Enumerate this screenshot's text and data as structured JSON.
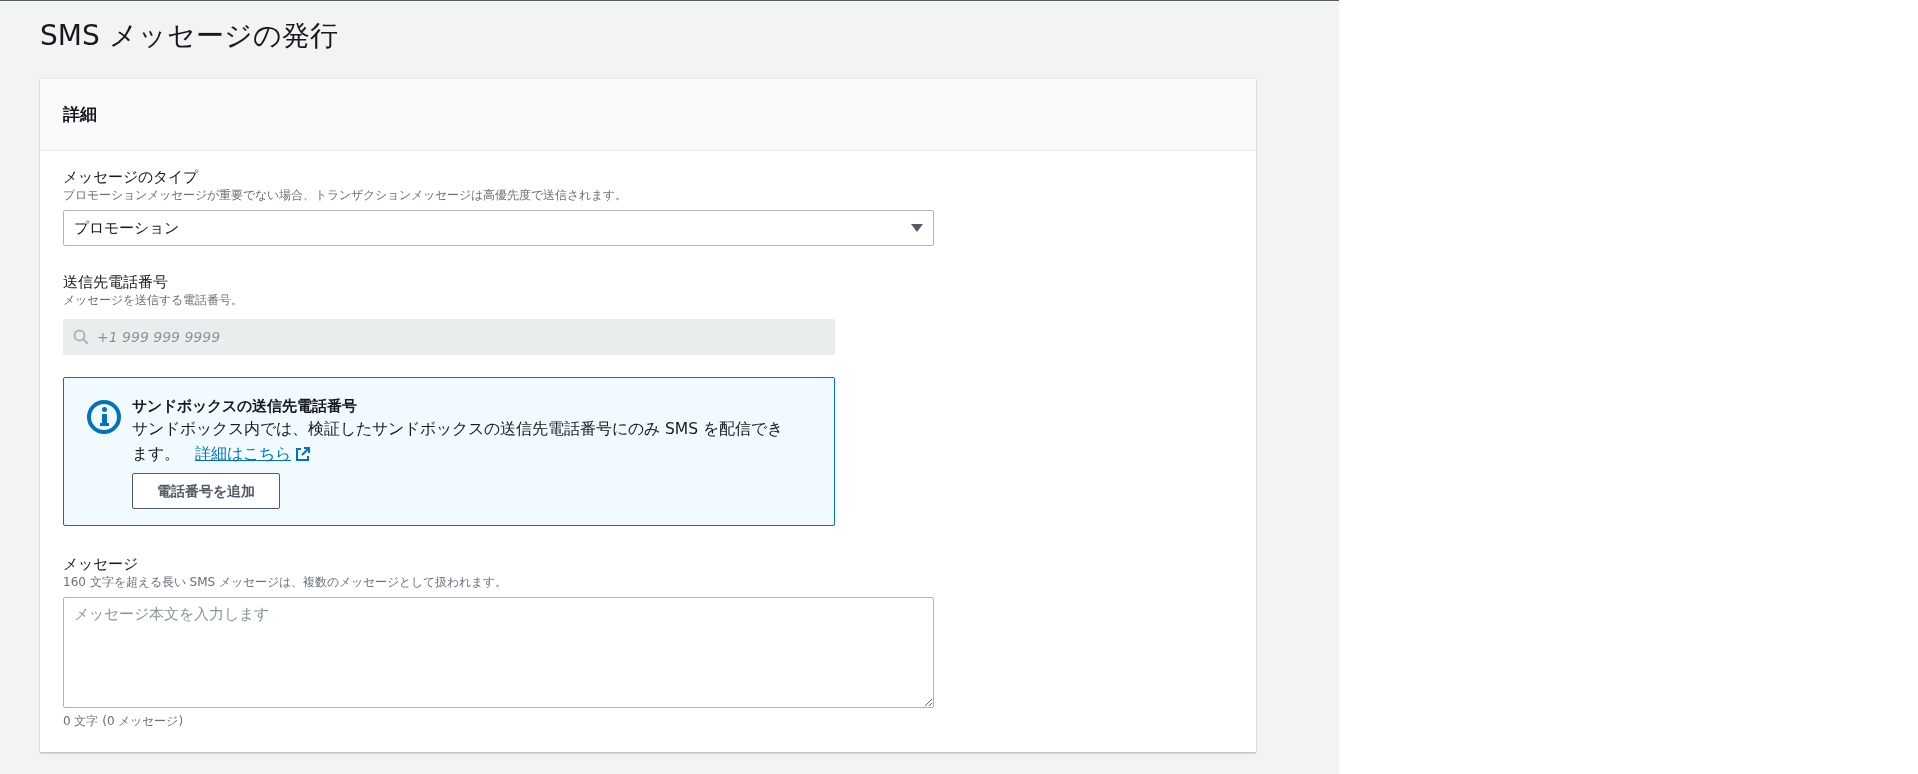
{
  "page_title": "SMS メッセージの発行",
  "panel": {
    "title": "詳細",
    "message_type": {
      "label": "メッセージのタイプ",
      "description": "プロモーションメッセージが重要でない場合、トランザクションメッセージは高優先度で送信されます。",
      "value": "プロモーション"
    },
    "phone": {
      "label": "送信先電話番号",
      "description": "メッセージを送信する電話番号。",
      "placeholder": "+1 999 999 9999"
    },
    "info": {
      "title": "サンドボックスの送信先電話番号",
      "text": "サンドボックス内では、検証したサンドボックスの送信先電話番号にのみ SMS を配信できます。",
      "link": "詳細はこちら",
      "button": "電話番号を追加"
    },
    "message": {
      "label": "メッセージ",
      "description": "160 文字を超える長い SMS メッセージは、複数のメッセージとして扱われます。",
      "placeholder": "メッセージ本文を入力します",
      "counter": "0 文字 (0 メッセージ)"
    }
  }
}
